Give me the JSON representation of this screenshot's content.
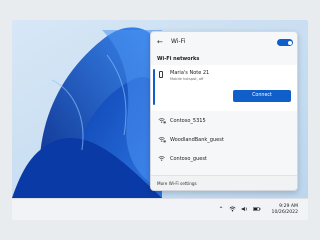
{
  "panel": {
    "title": "Wi-Fi",
    "section": "Wi-Fi networks",
    "back_icon": "arrow-left-icon",
    "toggle": {
      "state": "on",
      "accent": "#0f5ec9"
    },
    "hotspot": {
      "name": "Maria's Note 21",
      "status": "Mobile hotspot, off",
      "connect_label": "Connect",
      "icon": "phone-icon"
    },
    "networks": [
      {
        "name": "Contoso_5315",
        "icon": "secured-wifi-icon"
      },
      {
        "name": "WoodlandBank_guest",
        "icon": "secured-wifi-icon"
      },
      {
        "name": "Contoso_guest",
        "icon": "wifi-icon"
      }
    ],
    "more_label": "More Wi-Fi settings"
  },
  "taskbar": {
    "time": "9:29 AM",
    "date": "10/26/2022",
    "tray_icons": [
      "chevron-up-icon",
      "wifi-icon",
      "volume-icon",
      "battery-icon"
    ]
  },
  "colors": {
    "accent": "#0f5ec9",
    "panel_bg": "#f6f7f9",
    "wallpaper": "#1a53c9"
  }
}
